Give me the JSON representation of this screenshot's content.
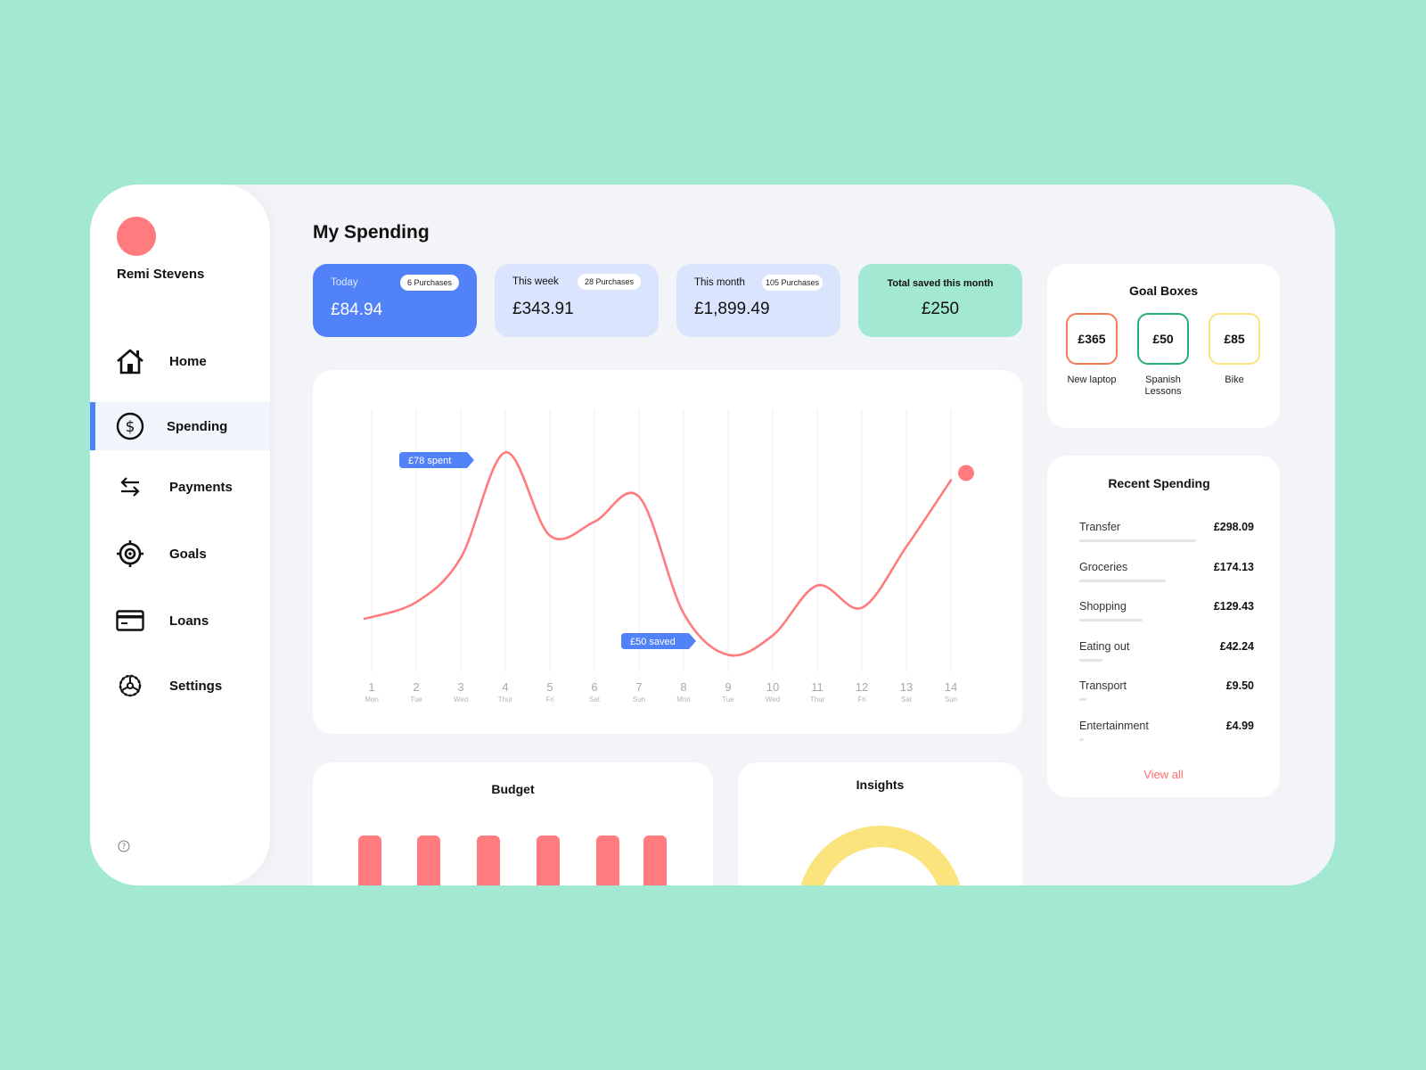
{
  "user": {
    "name": "Remi Stevens",
    "avatar_color": "#ff7b7e"
  },
  "sidebar": {
    "items": [
      {
        "label": "Home",
        "icon": "home-icon",
        "active": false
      },
      {
        "label": "Spending",
        "icon": "dollar-circle-icon",
        "active": true
      },
      {
        "label": "Payments",
        "icon": "transfer-arrows-icon",
        "active": false
      },
      {
        "label": "Goals",
        "icon": "target-icon",
        "active": false
      },
      {
        "label": "Loans",
        "icon": "credit-card-icon",
        "active": false
      },
      {
        "label": "Settings",
        "icon": "gear-icon",
        "active": false
      }
    ],
    "help_icon": "help-circle-icon"
  },
  "page": {
    "title": "My Spending"
  },
  "stats": [
    {
      "label": "Today",
      "badge": "6 Purchases",
      "value": "£84.94"
    },
    {
      "label": "This week",
      "badge": "28 Purchases",
      "value": "£343.91"
    },
    {
      "label": "This month",
      "badge": "105 Purchases",
      "value": "£1,899.49"
    },
    {
      "label": "Total saved this month",
      "value": "£250"
    }
  ],
  "colors": {
    "accent_blue": "#5282f7",
    "light_blue": "#dbe4fd",
    "mint": "#a2e8d3",
    "coral": "#ff7b7e",
    "goal_orange": "#f47c55",
    "goal_green": "#27ae72",
    "goal_yellow": "#fbe37d",
    "insight_yellow": "#fbe37d"
  },
  "chart_data": {
    "type": "line",
    "title": "",
    "x": [
      1,
      2,
      3,
      4,
      5,
      6,
      7,
      8,
      9,
      10,
      11,
      12,
      13,
      14
    ],
    "tick_labels": [
      "1",
      "2",
      "3",
      "4",
      "5",
      "6",
      "7",
      "8",
      "9",
      "10",
      "11",
      "12",
      "13",
      "14"
    ],
    "tick_sublabels": [
      "Mon",
      "Tue",
      "Wed",
      "Thur",
      "Fri",
      "Sat",
      "Sun",
      "Mon",
      "Tue",
      "Wed",
      "Thur",
      "Fri",
      "Sat",
      "Sun"
    ],
    "series": [
      {
        "name": "Spending",
        "color": "#ff7b7e",
        "values": [
          18,
          24,
          40,
          78,
          48,
          53,
          62,
          20,
          5,
          12,
          30,
          22,
          44,
          68
        ]
      }
    ],
    "ylim": [
      0,
      90
    ],
    "grid": "vertical",
    "annotations": [
      {
        "text": "£78 spent",
        "x": 4
      },
      {
        "text": "£50 saved",
        "x": 8
      }
    ],
    "end_marker": true
  },
  "budget": {
    "title": "Budget",
    "bars": 6
  },
  "insights": {
    "title": "Insights"
  },
  "goals": {
    "title": "Goal Boxes",
    "items": [
      {
        "amount": "£365",
        "label": "New laptop",
        "color": "#f47c55"
      },
      {
        "amount": "£50",
        "label": "Spanish Lessons",
        "color": "#27ae72"
      },
      {
        "amount": "£85",
        "label": "Bike",
        "color": "#fbe37d"
      }
    ]
  },
  "recent": {
    "title": "Recent Spending",
    "items": [
      {
        "name": "Transfer",
        "amount": "£298.09",
        "share": 1.0
      },
      {
        "name": "Groceries",
        "amount": "£174.13",
        "share": 0.74
      },
      {
        "name": "Shopping",
        "amount": "£129.43",
        "share": 0.54
      },
      {
        "name": "Eating out",
        "amount": "£42.24",
        "share": 0.2
      },
      {
        "name": "Transport",
        "amount": "£9.50",
        "share": 0.06
      },
      {
        "name": "Entertainment",
        "amount": "£4.99",
        "share": 0.03
      }
    ],
    "view_all": "View all"
  }
}
